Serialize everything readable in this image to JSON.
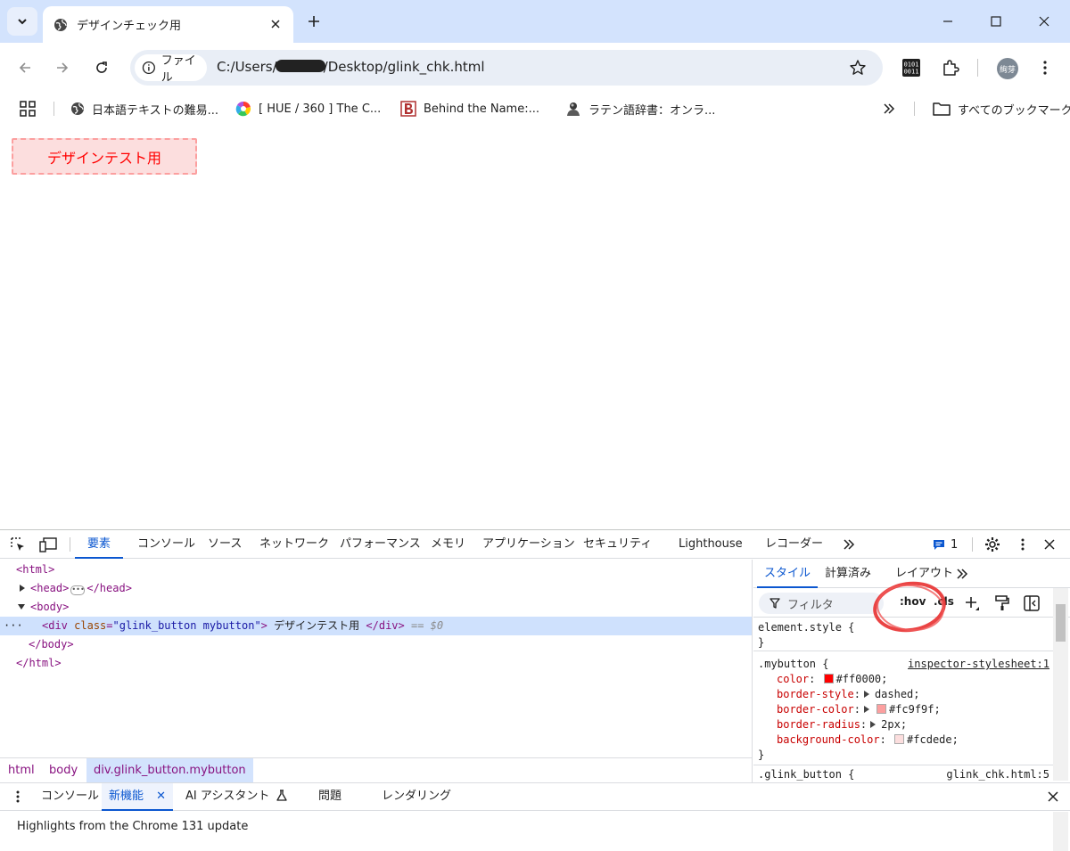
{
  "tab": {
    "title": "デザインチェック用"
  },
  "toolbar": {
    "origin_chip": "ファイル",
    "url_prefix": "C:/Users/",
    "url_suffix": "/Desktop/glink_chk.html",
    "avatar_text": "絢芽"
  },
  "bookmarks": [
    {
      "label": "日本語テキストの難易...",
      "icon": "globe-icon"
    },
    {
      "label": "[ HUE / 360 ] The C...",
      "icon": "color-wheel-icon"
    },
    {
      "label": "Behind the Name:...",
      "icon": "behind-the-name-logo"
    },
    {
      "label": "ラテン語辞書：オンラ...",
      "icon": "portrait-icon"
    }
  ],
  "bookmarks_all": "すべてのブックマーク",
  "page": {
    "button_label": "デザインテスト用"
  },
  "devtools": {
    "tabs": [
      "要素",
      "コンソール",
      "ソース",
      "ネットワーク",
      "パフォーマンス",
      "メモリ",
      "アプリケーション",
      "セキュリティ",
      "Lighthouse",
      "レコーダー"
    ],
    "issues_count": "1",
    "elements": {
      "html_open": "<html>",
      "head_open": "<head>",
      "head_close": "</head>",
      "body_open": "<body>",
      "div_tag_open": "<div",
      "div_attr_name": "class",
      "div_attr_value": "\"glink_button mybutton\"",
      "div_text": "デザインテスト用",
      "div_close": "</div>",
      "dollar_zero": "== $0",
      "body_close": "</body>",
      "html_close": "</html>"
    },
    "breadcrumbs": [
      "html",
      "body",
      "div.glink_button.mybutton"
    ],
    "styles_tabs": [
      "スタイル",
      "計算済み",
      "レイアウト"
    ],
    "filter_placeholder": "フィルタ",
    "hov": ":hov",
    "cls": ".cls",
    "rules": {
      "element_style": "element.style {",
      "close_brace": "}",
      "mybutton_selector": ".mybutton {",
      "mybutton_source": "inspector-stylesheet:1",
      "props": [
        {
          "name": "color",
          "value": "#ff0000;",
          "swatch": "#ff0000",
          "expand": false
        },
        {
          "name": "border-style",
          "value": "dashed;",
          "swatch": "",
          "expand": true
        },
        {
          "name": "border-color",
          "value": "#fc9f9f;",
          "swatch": "#fc9f9f",
          "expand": true
        },
        {
          "name": "border-radius",
          "value": "2px;",
          "swatch": "",
          "expand": true
        },
        {
          "name": "background-color",
          "value": "#fcdede;",
          "swatch": "#fcdede",
          "expand": false
        }
      ],
      "glink_selector": ".glink_button {",
      "glink_source": "glink_chk.html:5"
    },
    "drawer_tabs": [
      "コンソール",
      "新機能",
      "AI アシスタント",
      "問題",
      "レンダリング"
    ],
    "drawer_message": "Highlights from the Chrome 131 update"
  },
  "colors": {
    "accent": "#0b57d0",
    "tabstrip": "#d3e3fd",
    "annotation": "#e83030"
  }
}
